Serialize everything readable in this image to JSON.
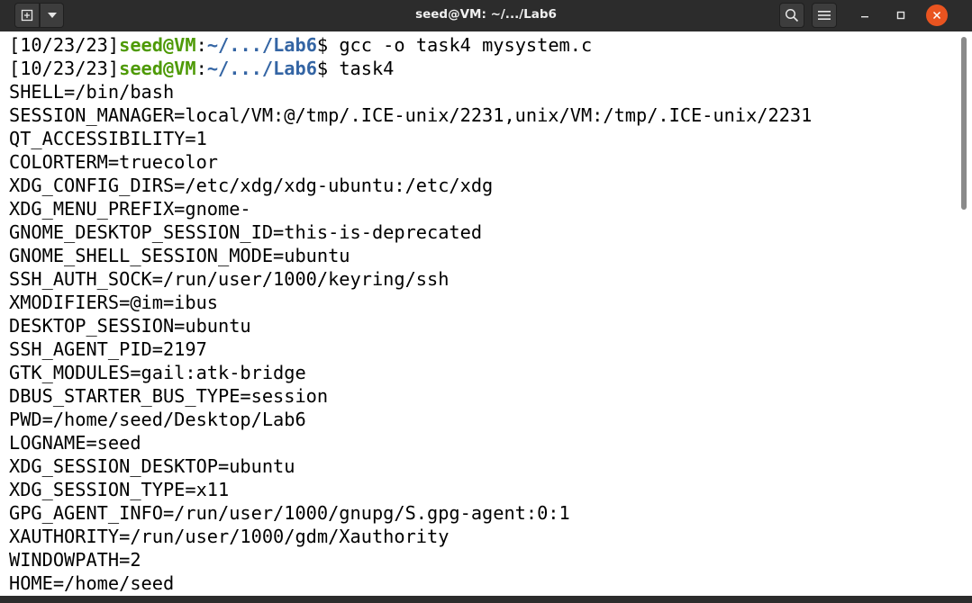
{
  "window": {
    "title": "seed@VM: ~/.../Lab6",
    "accent_close": "#e95420"
  },
  "icons": {
    "new_tab": "new-tab-icon",
    "dropdown": "chevron-down-icon",
    "search": "search-icon",
    "menu": "hamburger-menu-icon",
    "minimize": "minimize-icon",
    "maximize": "maximize-icon",
    "close": "close-icon"
  },
  "colors": {
    "prompt_user": "#4e9a06",
    "prompt_path": "#3465a4",
    "terminal_bg": "#ffffff",
    "text": "#000000"
  },
  "terminal": {
    "prompts": [
      {
        "date": "[10/23/23]",
        "user": "seed@VM",
        "sep": ":",
        "path": "~/.../Lab6",
        "symbol": "$ ",
        "command": "gcc -o task4 mysystem.c"
      },
      {
        "date": "[10/23/23]",
        "user": "seed@VM",
        "sep": ":",
        "path": "~/.../Lab6",
        "symbol": "$ ",
        "command": "task4"
      }
    ],
    "output": [
      "SHELL=/bin/bash",
      "SESSION_MANAGER=local/VM:@/tmp/.ICE-unix/2231,unix/VM:/tmp/.ICE-unix/2231",
      "QT_ACCESSIBILITY=1",
      "COLORTERM=truecolor",
      "XDG_CONFIG_DIRS=/etc/xdg/xdg-ubuntu:/etc/xdg",
      "XDG_MENU_PREFIX=gnome-",
      "GNOME_DESKTOP_SESSION_ID=this-is-deprecated",
      "GNOME_SHELL_SESSION_MODE=ubuntu",
      "SSH_AUTH_SOCK=/run/user/1000/keyring/ssh",
      "XMODIFIERS=@im=ibus",
      "DESKTOP_SESSION=ubuntu",
      "SSH_AGENT_PID=2197",
      "GTK_MODULES=gail:atk-bridge",
      "DBUS_STARTER_BUS_TYPE=session",
      "PWD=/home/seed/Desktop/Lab6",
      "LOGNAME=seed",
      "XDG_SESSION_DESKTOP=ubuntu",
      "XDG_SESSION_TYPE=x11",
      "GPG_AGENT_INFO=/run/user/1000/gnupg/S.gpg-agent:0:1",
      "XAUTHORITY=/run/user/1000/gdm/Xauthority",
      "WINDOWPATH=2",
      "HOME=/home/seed"
    ]
  }
}
